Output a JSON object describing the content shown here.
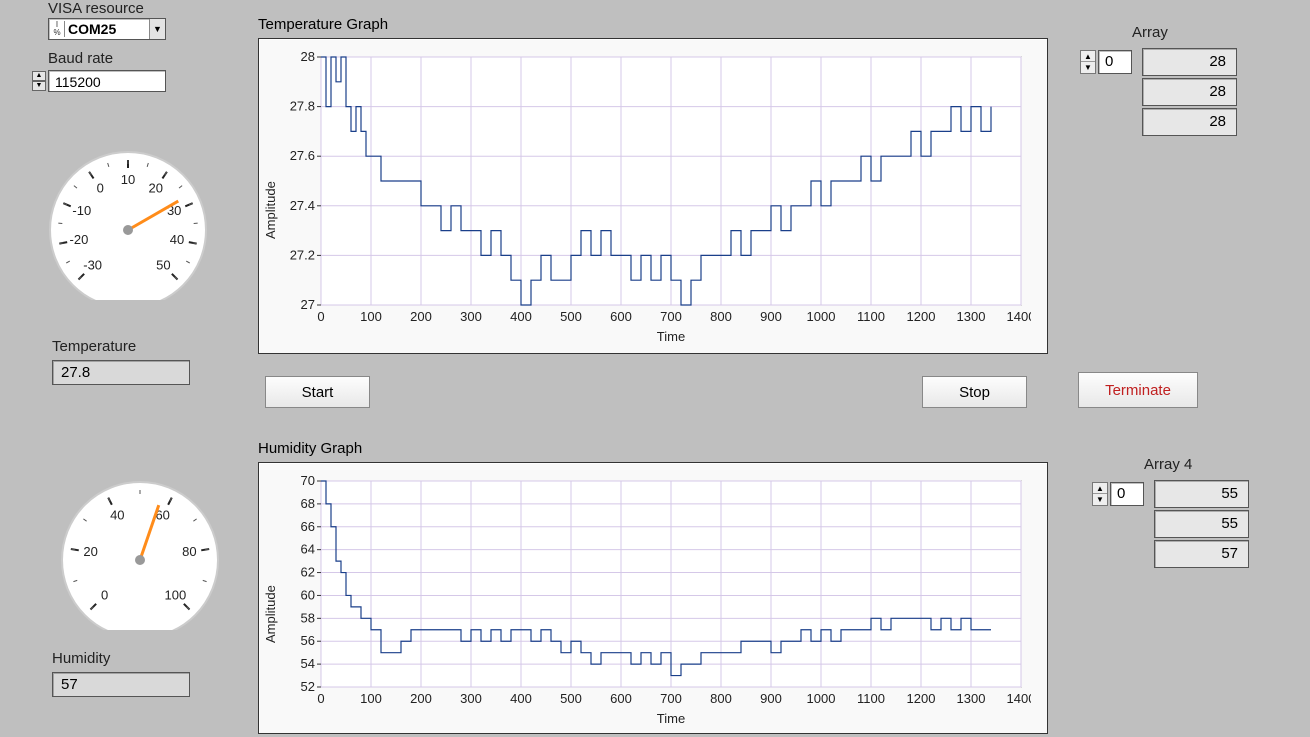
{
  "visa": {
    "label": "VISA resource",
    "value": "COM25"
  },
  "baud": {
    "label": "Baud rate",
    "value": "115200"
  },
  "temp": {
    "label": "Temperature",
    "value": "27.8"
  },
  "humidity": {
    "label": "Humidity",
    "value": "57"
  },
  "buttons": {
    "start": "Start",
    "stop": "Stop",
    "terminate": "Terminate"
  },
  "array1": {
    "label": "Array",
    "index": "0",
    "values": [
      "28",
      "28",
      "28"
    ]
  },
  "array4": {
    "label": "Array 4",
    "index": "0",
    "values": [
      "55",
      "55",
      "57"
    ]
  },
  "gauge_temp": {
    "ticks": [
      "-30",
      "-20",
      "-10",
      "0",
      "10",
      "20",
      "30",
      "40",
      "50"
    ],
    "value": 27.8,
    "min": -30,
    "max": 50
  },
  "gauge_hum": {
    "ticks": [
      "0",
      "20",
      "40",
      "60",
      "80",
      "100"
    ],
    "value": 57,
    "min": 0,
    "max": 100
  },
  "chart_data": [
    {
      "type": "line",
      "title": "Temperature Graph",
      "xlabel": "Time",
      "ylabel": "Amplitude",
      "xlim": [
        0,
        1400
      ],
      "ylim": [
        27,
        28
      ],
      "xticks": [
        0,
        100,
        200,
        300,
        400,
        500,
        600,
        700,
        800,
        900,
        1000,
        1100,
        1200,
        1300,
        1400
      ],
      "yticks": [
        27,
        27.2,
        27.4,
        27.6,
        27.8,
        28
      ],
      "series": [
        {
          "name": "Temperature",
          "x": [
            0,
            10,
            20,
            30,
            40,
            50,
            60,
            70,
            80,
            90,
            100,
            120,
            140,
            160,
            180,
            200,
            220,
            240,
            260,
            280,
            300,
            320,
            340,
            360,
            380,
            400,
            420,
            440,
            460,
            480,
            500,
            520,
            540,
            560,
            580,
            600,
            620,
            640,
            660,
            680,
            700,
            720,
            740,
            760,
            780,
            800,
            820,
            840,
            860,
            880,
            900,
            920,
            940,
            960,
            980,
            1000,
            1020,
            1040,
            1060,
            1080,
            1100,
            1120,
            1140,
            1160,
            1180,
            1200,
            1220,
            1240,
            1260,
            1280,
            1300,
            1320,
            1340
          ],
          "y": [
            28,
            27.8,
            28,
            27.9,
            28,
            27.8,
            27.7,
            27.8,
            27.7,
            27.6,
            27.6,
            27.5,
            27.5,
            27.5,
            27.5,
            27.4,
            27.4,
            27.3,
            27.4,
            27.3,
            27.3,
            27.2,
            27.3,
            27.2,
            27.1,
            27,
            27.1,
            27.2,
            27.1,
            27.1,
            27.2,
            27.3,
            27.2,
            27.3,
            27.2,
            27.2,
            27.1,
            27.2,
            27.1,
            27.2,
            27.1,
            27,
            27.1,
            27.2,
            27.2,
            27.2,
            27.3,
            27.2,
            27.3,
            27.3,
            27.4,
            27.3,
            27.4,
            27.4,
            27.5,
            27.4,
            27.5,
            27.5,
            27.5,
            27.6,
            27.5,
            27.6,
            27.6,
            27.6,
            27.7,
            27.6,
            27.7,
            27.7,
            27.8,
            27.7,
            27.8,
            27.7,
            27.8
          ]
        }
      ]
    },
    {
      "type": "line",
      "title": "Humidity Graph",
      "xlabel": "Time",
      "ylabel": "Amplitude",
      "xlim": [
        0,
        1400
      ],
      "ylim": [
        52,
        70
      ],
      "xticks": [
        0,
        100,
        200,
        300,
        400,
        500,
        600,
        700,
        800,
        900,
        1000,
        1100,
        1200,
        1300,
        1400
      ],
      "yticks": [
        52,
        54,
        56,
        58,
        60,
        62,
        64,
        66,
        68,
        70
      ],
      "series": [
        {
          "name": "Humidity",
          "x": [
            0,
            10,
            20,
            30,
            40,
            50,
            60,
            80,
            100,
            120,
            140,
            160,
            180,
            200,
            220,
            240,
            260,
            280,
            300,
            320,
            340,
            360,
            380,
            400,
            420,
            440,
            460,
            480,
            500,
            520,
            540,
            560,
            580,
            600,
            620,
            640,
            660,
            680,
            700,
            720,
            740,
            760,
            780,
            800,
            820,
            840,
            860,
            880,
            900,
            920,
            940,
            960,
            980,
            1000,
            1020,
            1040,
            1060,
            1080,
            1100,
            1120,
            1140,
            1160,
            1180,
            1200,
            1220,
            1240,
            1260,
            1280,
            1300,
            1320,
            1340
          ],
          "y": [
            70,
            68,
            66,
            63,
            62,
            60,
            59,
            58,
            57,
            55,
            55,
            56,
            57,
            57,
            57,
            57,
            57,
            56,
            57,
            56,
            57,
            56,
            57,
            57,
            56,
            57,
            56,
            55,
            56,
            55,
            54,
            55,
            55,
            55,
            54,
            55,
            54,
            55,
            53,
            54,
            54,
            55,
            55,
            55,
            55,
            56,
            56,
            56,
            55,
            56,
            56,
            57,
            56,
            57,
            56,
            57,
            57,
            57,
            58,
            57,
            58,
            58,
            58,
            58,
            57,
            58,
            57,
            58,
            57,
            57,
            57
          ]
        }
      ]
    }
  ]
}
